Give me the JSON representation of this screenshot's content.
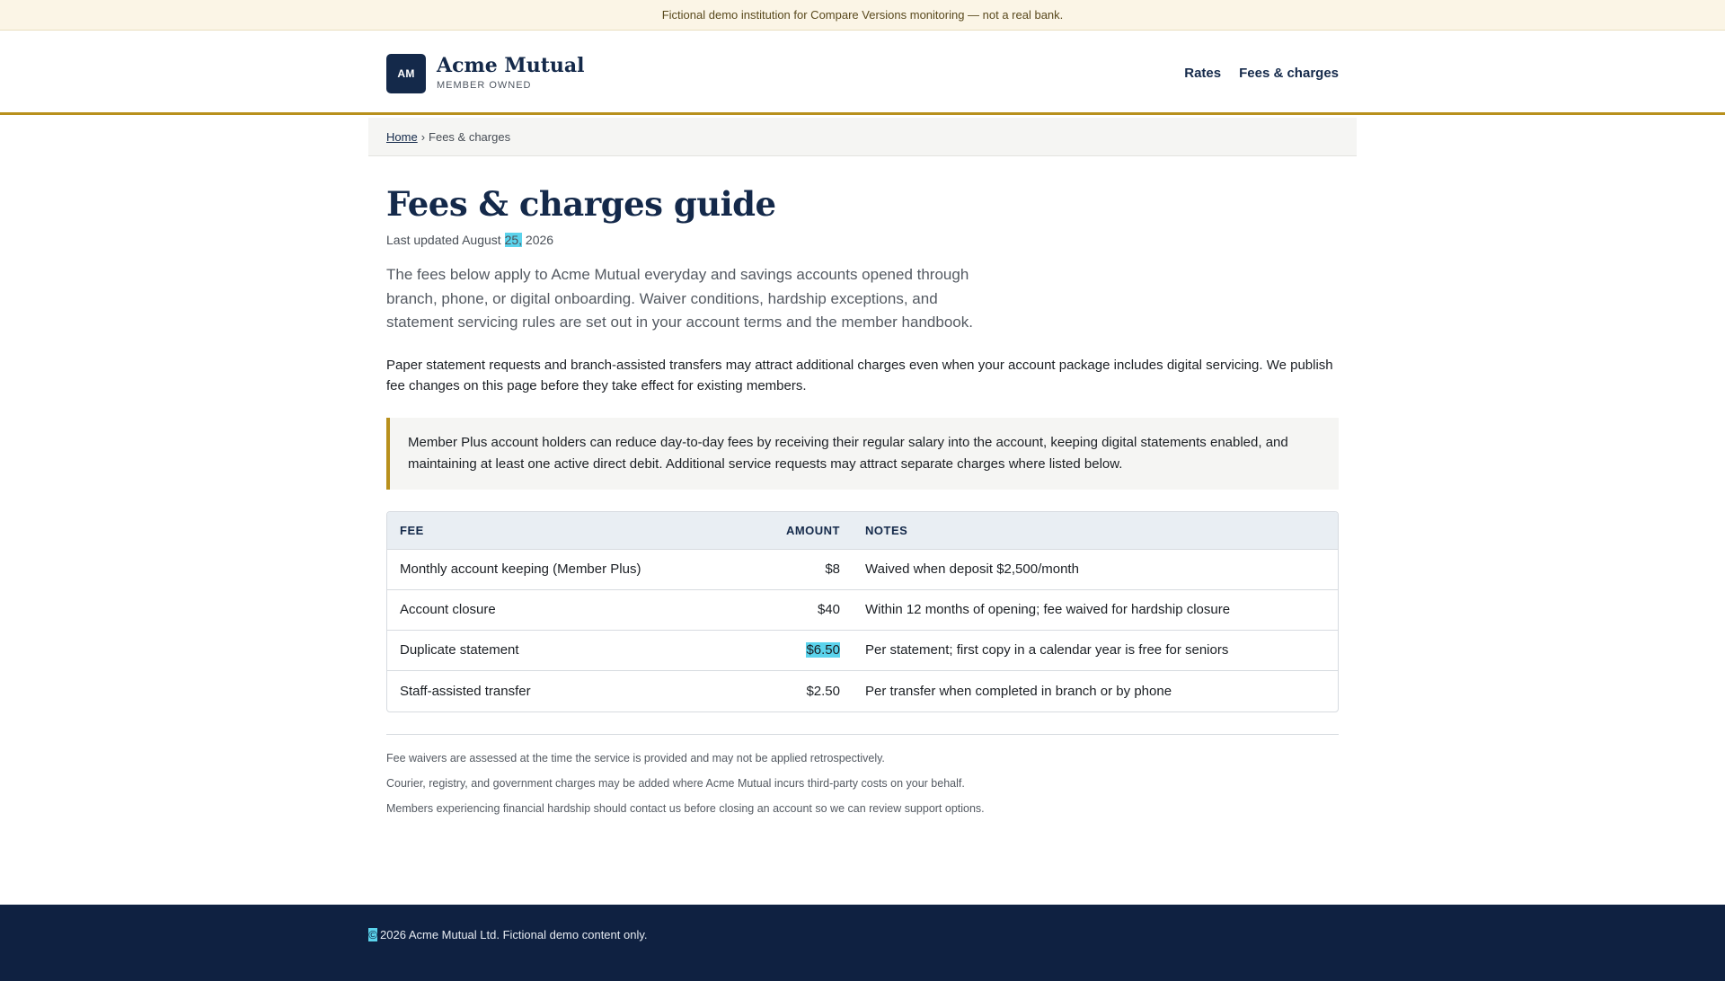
{
  "demo_banner": {
    "text": "Fictional demo institution for Compare Versions monitoring — not a real bank."
  },
  "header": {
    "logo_initials": "AM",
    "brand_name": "Acme Mutual",
    "brand_tagline": "MEMBER OWNED",
    "nav": [
      {
        "label": "Rates"
      },
      {
        "label": "Fees & charges"
      }
    ]
  },
  "breadcrumb": {
    "home": "Home",
    "separator": "›",
    "current": "Fees & charges"
  },
  "main": {
    "title": "Fees & charges guide",
    "updated_prefix": "Last updated August ",
    "updated_day": "25,",
    "updated_year": " 2026",
    "lead": "The fees below apply to Acme Mutual everyday and savings accounts opened through branch, phone, or digital onboarding. Waiver conditions, hardship exceptions, and statement servicing rules are set out in your account terms and the member handbook.",
    "paragraph": "Paper statement requests and branch-assisted transfers may attract additional charges even when your account package includes digital servicing. We publish fee changes on this page before they take effect for existing members.",
    "callout": "Member Plus account holders can reduce day-to-day fees by receiving their regular salary into the account, keeping digital statements enabled, and maintaining at least one active direct debit. Additional service requests may attract separate charges where listed below."
  },
  "fee_table": {
    "headers": {
      "fee": "FEE",
      "amount": "AMOUNT",
      "notes": "NOTES"
    },
    "rows": [
      {
        "fee": "Monthly account keeping (Member Plus)",
        "amount": "$8",
        "notes": "Waived when deposit $2,500/month"
      },
      {
        "fee": "Account closure",
        "amount": "$40",
        "notes": "Within 12 months of opening; fee waived for hardship closure"
      },
      {
        "fee": "Duplicate statement",
        "amount": "$6.50",
        "notes": "Per statement; first copy in a calendar year is free for seniors"
      },
      {
        "fee": "Staff-assisted transfer",
        "amount": "$2.50",
        "notes": "Per transfer when completed in branch or by phone"
      }
    ]
  },
  "footnotes": [
    "Fee waivers are assessed at the time the service is provided and may not be applied retrospectively.",
    "Courier, registry, and government charges may be added where Acme Mutual incurs third-party costs on your behalf.",
    "Members experiencing financial hardship should contact us before closing an account so we can review support options."
  ],
  "footer": {
    "copyright_mark": "©",
    "text": "2026 Acme Mutual Ltd. Fictional demo content only."
  },
  "colors": {
    "navy": "#14294a",
    "gold_accent": "#b8901c",
    "highlight": "#5bd3ec",
    "footer_bg": "#0f2141"
  }
}
